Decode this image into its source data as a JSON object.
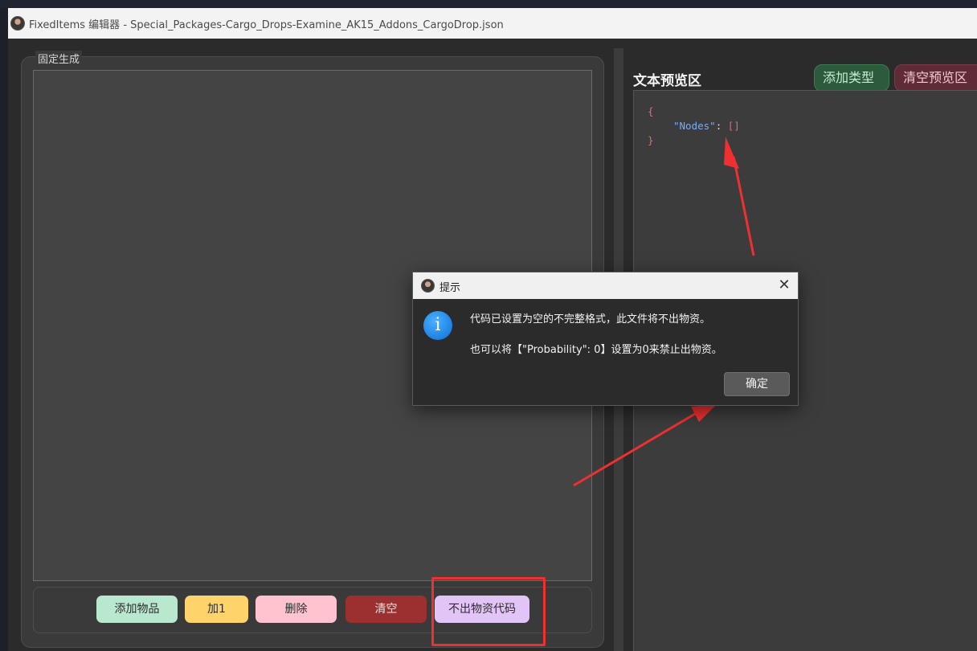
{
  "window": {
    "title": "FixedItems 编辑器 - Special_Packages-Cargo_Drops-Examine_AK15_Addons_CargoDrop.json"
  },
  "left_panel": {
    "group_title": "固定生成",
    "buttons": {
      "add_item": "添加物品",
      "plus_one": "加1",
      "delete": "删除",
      "clear": "清空",
      "no_drop_code": "不出物资代码"
    }
  },
  "right_panel": {
    "title": "文本预览区",
    "add_type": "添加类型",
    "clear_preview": "清空预览区",
    "code": {
      "open_brace": "{",
      "key": "\"Nodes\"",
      "colon": ": ",
      "value": "[]",
      "close_brace": "}"
    }
  },
  "dialog": {
    "title": "提示",
    "close_glyph": "✕",
    "icon_glyph": "i",
    "message_line1": "代码已设置为空的不完整格式，此文件将不出物资。",
    "message_line2": "也可以将【\"Probability\": 0】设置为0来禁止出物资。",
    "ok": "确定"
  },
  "colors": {
    "annotation_red": "#ef3030",
    "btn_add_item": "#b8e9cf",
    "btn_plus_one": "#fdd36a",
    "btn_delete": "#ffc2cf",
    "btn_clear": "#9c3030",
    "btn_no_drop": "#e3c4f7",
    "json_key": "#7aaaf6",
    "json_brace": "#e06c6c"
  }
}
